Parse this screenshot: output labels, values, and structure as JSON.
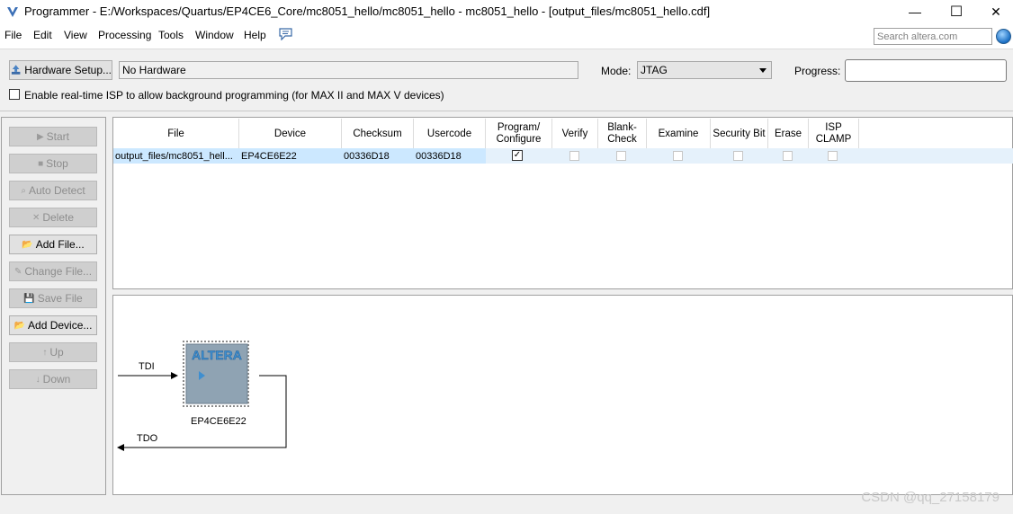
{
  "window": {
    "title": "Programmer - E:/Workspaces/Quartus/EP4CE6_Core/mc8051_hello/mc8051_hello - mc8051_hello - [output_files/mc8051_hello.cdf]",
    "minimize_glyph": "—",
    "maximize_glyph": "☐",
    "close_glyph": "✕"
  },
  "menu": {
    "items": [
      "File",
      "Edit",
      "View",
      "Processing",
      "Tools",
      "Window",
      "Help"
    ],
    "search_placeholder": "Search altera.com"
  },
  "hardware": {
    "setup_label": "Hardware Setup...",
    "value": "No Hardware",
    "mode_label": "Mode:",
    "mode_value": "JTAG",
    "progress_label": "Progress:",
    "progress_value": 0
  },
  "isp": {
    "checked": false,
    "label": "Enable real-time ISP to allow background programming (for MAX II and MAX V devices)"
  },
  "sidebar": {
    "buttons": [
      {
        "label": "Start",
        "enabled": false,
        "icon": "start-icon"
      },
      {
        "label": "Stop",
        "enabled": false,
        "icon": "stop-icon"
      },
      {
        "label": "Auto Detect",
        "enabled": false,
        "icon": "auto-detect-icon"
      },
      {
        "label": "Delete",
        "enabled": false,
        "icon": "delete-icon"
      },
      {
        "label": "Add File...",
        "enabled": true,
        "icon": "add-file-icon"
      },
      {
        "label": "Change File...",
        "enabled": false,
        "icon": "change-file-icon"
      },
      {
        "label": "Save File",
        "enabled": false,
        "icon": "save-file-icon"
      },
      {
        "label": "Add Device...",
        "enabled": true,
        "icon": "add-device-icon"
      },
      {
        "label": "Up",
        "enabled": false,
        "icon": "up-icon"
      },
      {
        "label": "Down",
        "enabled": false,
        "icon": "down-icon"
      }
    ]
  },
  "table": {
    "headers": [
      "File",
      "Device",
      "Checksum",
      "Usercode",
      "Program/ Configure",
      "Verify",
      "Blank- Check",
      "Examine",
      "Security Bit",
      "Erase",
      "ISP CLAMP"
    ],
    "rows": [
      {
        "file": "output_files/mc8051_hell...",
        "device": "EP4CE6E22",
        "checksum": "00336D18",
        "usercode": "00336D18",
        "program": true,
        "verify": false,
        "blank_check": false,
        "examine": false,
        "security_bit": false,
        "erase": false,
        "isp_clamp": false
      }
    ]
  },
  "chain": {
    "tdi_label": "TDI",
    "tdo_label": "TDO",
    "device_name": "EP4CE6E22",
    "chip_logo": "ALTERA"
  },
  "watermark": "CSDN @qq_27158179",
  "colors": {
    "selected_row": "#e5f1fb",
    "chip_fill": "#8fa3b3",
    "logo_blue": "#3f8fd0"
  }
}
